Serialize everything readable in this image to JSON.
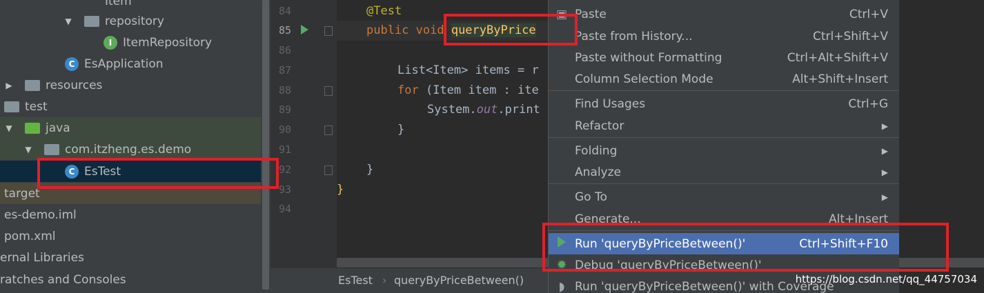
{
  "project_tree": {
    "items": [
      {
        "label": "Item"
      },
      {
        "label": "repository"
      },
      {
        "label": "ItemRepository"
      },
      {
        "label": "EsApplication"
      },
      {
        "label": "resources"
      },
      {
        "label": "test"
      },
      {
        "label": "java"
      },
      {
        "label": "com.itzheng.es.demo"
      },
      {
        "label": "EsTest"
      },
      {
        "label": "target"
      },
      {
        "label": "es-demo.iml"
      },
      {
        "label": "pom.xml"
      },
      {
        "label": "ernal Libraries"
      },
      {
        "label": "ratches and Consoles"
      }
    ]
  },
  "editor": {
    "lines": [
      {
        "num": "84",
        "code": "@Test"
      },
      {
        "num": "85",
        "code_kw": "public void ",
        "code_fn": "queryByPrice"
      },
      {
        "num": "86",
        "code": ""
      },
      {
        "num": "87",
        "code_a": "List<Item> ",
        "code_b": "items = r"
      },
      {
        "num": "88",
        "code_kw": "for ",
        "code_b": "(Item item : ite"
      },
      {
        "num": "89",
        "code_a": "System.",
        "code_it": "out",
        "code_b": ".print"
      },
      {
        "num": "90",
        "code": "}"
      },
      {
        "num": "91",
        "code": ""
      },
      {
        "num": "92",
        "code": "}"
      },
      {
        "num": "93",
        "code": "}"
      },
      {
        "num": "94",
        "code": ""
      }
    ]
  },
  "breadcrumb": {
    "class": "EsTest",
    "sep": "›",
    "method": "queryByPriceBetween()"
  },
  "context_menu": {
    "items": [
      {
        "label": "Paste",
        "shortcut": "Ctrl+V"
      },
      {
        "label": "Paste from History...",
        "shortcut": "Ctrl+Shift+V"
      },
      {
        "label": "Paste without Formatting",
        "shortcut": "Ctrl+Alt+Shift+V"
      },
      {
        "label": "Column Selection Mode",
        "shortcut": "Alt+Shift+Insert"
      },
      {
        "label": "Find Usages",
        "shortcut": "Ctrl+G"
      },
      {
        "label": "Refactor",
        "shortcut": "▶"
      },
      {
        "label": "Folding",
        "shortcut": "▶"
      },
      {
        "label": "Analyze",
        "shortcut": "▶"
      },
      {
        "label": "Go To",
        "shortcut": "▶"
      },
      {
        "label": "Generate...",
        "shortcut": "Alt+Insert"
      },
      {
        "label": "Run 'queryByPriceBetween()'",
        "shortcut": "Ctrl+Shift+F10"
      },
      {
        "label": "Debug 'queryByPriceBetween()'",
        "shortcut": ""
      },
      {
        "label": "Run 'queryByPriceBetween()' with Coverage",
        "shortcut": ""
      }
    ]
  },
  "watermark": "https://blog.csdn.net/qq_44757034",
  "colors": {
    "accent_red": "#e0202a",
    "selection": "#4b6eaf",
    "keyword": "#cc7832",
    "function": "#ffc66d",
    "annotation": "#bbb529"
  }
}
